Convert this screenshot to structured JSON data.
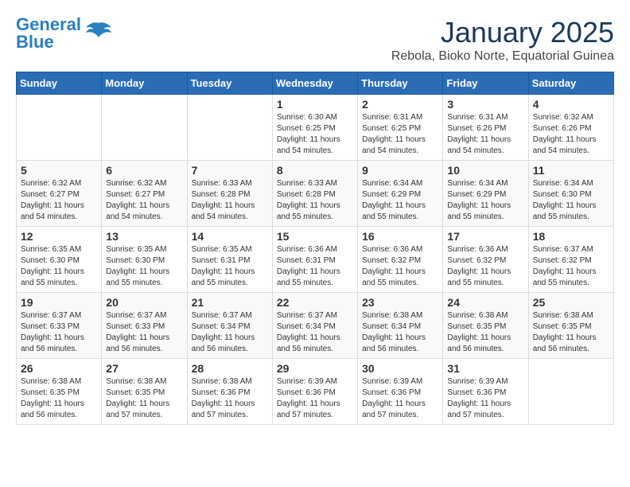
{
  "header": {
    "logo_line1_part1": "General",
    "logo_line2": "Blue",
    "month_title": "January 2025",
    "location": "Rebola, Bioko Norte, Equatorial Guinea"
  },
  "days_of_week": [
    "Sunday",
    "Monday",
    "Tuesday",
    "Wednesday",
    "Thursday",
    "Friday",
    "Saturday"
  ],
  "weeks": [
    [
      {
        "day": "",
        "content": ""
      },
      {
        "day": "",
        "content": ""
      },
      {
        "day": "",
        "content": ""
      },
      {
        "day": "1",
        "content": "Sunrise: 6:30 AM\nSunset: 6:25 PM\nDaylight: 11 hours\nand 54 minutes."
      },
      {
        "day": "2",
        "content": "Sunrise: 6:31 AM\nSunset: 6:25 PM\nDaylight: 11 hours\nand 54 minutes."
      },
      {
        "day": "3",
        "content": "Sunrise: 6:31 AM\nSunset: 6:26 PM\nDaylight: 11 hours\nand 54 minutes."
      },
      {
        "day": "4",
        "content": "Sunrise: 6:32 AM\nSunset: 6:26 PM\nDaylight: 11 hours\nand 54 minutes."
      }
    ],
    [
      {
        "day": "5",
        "content": "Sunrise: 6:32 AM\nSunset: 6:27 PM\nDaylight: 11 hours\nand 54 minutes."
      },
      {
        "day": "6",
        "content": "Sunrise: 6:32 AM\nSunset: 6:27 PM\nDaylight: 11 hours\nand 54 minutes."
      },
      {
        "day": "7",
        "content": "Sunrise: 6:33 AM\nSunset: 6:28 PM\nDaylight: 11 hours\nand 54 minutes."
      },
      {
        "day": "8",
        "content": "Sunrise: 6:33 AM\nSunset: 6:28 PM\nDaylight: 11 hours\nand 55 minutes."
      },
      {
        "day": "9",
        "content": "Sunrise: 6:34 AM\nSunset: 6:29 PM\nDaylight: 11 hours\nand 55 minutes."
      },
      {
        "day": "10",
        "content": "Sunrise: 6:34 AM\nSunset: 6:29 PM\nDaylight: 11 hours\nand 55 minutes."
      },
      {
        "day": "11",
        "content": "Sunrise: 6:34 AM\nSunset: 6:30 PM\nDaylight: 11 hours\nand 55 minutes."
      }
    ],
    [
      {
        "day": "12",
        "content": "Sunrise: 6:35 AM\nSunset: 6:30 PM\nDaylight: 11 hours\nand 55 minutes."
      },
      {
        "day": "13",
        "content": "Sunrise: 6:35 AM\nSunset: 6:30 PM\nDaylight: 11 hours\nand 55 minutes."
      },
      {
        "day": "14",
        "content": "Sunrise: 6:35 AM\nSunset: 6:31 PM\nDaylight: 11 hours\nand 55 minutes."
      },
      {
        "day": "15",
        "content": "Sunrise: 6:36 AM\nSunset: 6:31 PM\nDaylight: 11 hours\nand 55 minutes."
      },
      {
        "day": "16",
        "content": "Sunrise: 6:36 AM\nSunset: 6:32 PM\nDaylight: 11 hours\nand 55 minutes."
      },
      {
        "day": "17",
        "content": "Sunrise: 6:36 AM\nSunset: 6:32 PM\nDaylight: 11 hours\nand 55 minutes."
      },
      {
        "day": "18",
        "content": "Sunrise: 6:37 AM\nSunset: 6:32 PM\nDaylight: 11 hours\nand 55 minutes."
      }
    ],
    [
      {
        "day": "19",
        "content": "Sunrise: 6:37 AM\nSunset: 6:33 PM\nDaylight: 11 hours\nand 56 minutes."
      },
      {
        "day": "20",
        "content": "Sunrise: 6:37 AM\nSunset: 6:33 PM\nDaylight: 11 hours\nand 56 minutes."
      },
      {
        "day": "21",
        "content": "Sunrise: 6:37 AM\nSunset: 6:34 PM\nDaylight: 11 hours\nand 56 minutes."
      },
      {
        "day": "22",
        "content": "Sunrise: 6:37 AM\nSunset: 6:34 PM\nDaylight: 11 hours\nand 56 minutes."
      },
      {
        "day": "23",
        "content": "Sunrise: 6:38 AM\nSunset: 6:34 PM\nDaylight: 11 hours\nand 56 minutes."
      },
      {
        "day": "24",
        "content": "Sunrise: 6:38 AM\nSunset: 6:35 PM\nDaylight: 11 hours\nand 56 minutes."
      },
      {
        "day": "25",
        "content": "Sunrise: 6:38 AM\nSunset: 6:35 PM\nDaylight: 11 hours\nand 56 minutes."
      }
    ],
    [
      {
        "day": "26",
        "content": "Sunrise: 6:38 AM\nSunset: 6:35 PM\nDaylight: 11 hours\nand 56 minutes."
      },
      {
        "day": "27",
        "content": "Sunrise: 6:38 AM\nSunset: 6:35 PM\nDaylight: 11 hours\nand 57 minutes."
      },
      {
        "day": "28",
        "content": "Sunrise: 6:38 AM\nSunset: 6:36 PM\nDaylight: 11 hours\nand 57 minutes."
      },
      {
        "day": "29",
        "content": "Sunrise: 6:39 AM\nSunset: 6:36 PM\nDaylight: 11 hours\nand 57 minutes."
      },
      {
        "day": "30",
        "content": "Sunrise: 6:39 AM\nSunset: 6:36 PM\nDaylight: 11 hours\nand 57 minutes."
      },
      {
        "day": "31",
        "content": "Sunrise: 6:39 AM\nSunset: 6:36 PM\nDaylight: 11 hours\nand 57 minutes."
      },
      {
        "day": "",
        "content": ""
      }
    ]
  ]
}
